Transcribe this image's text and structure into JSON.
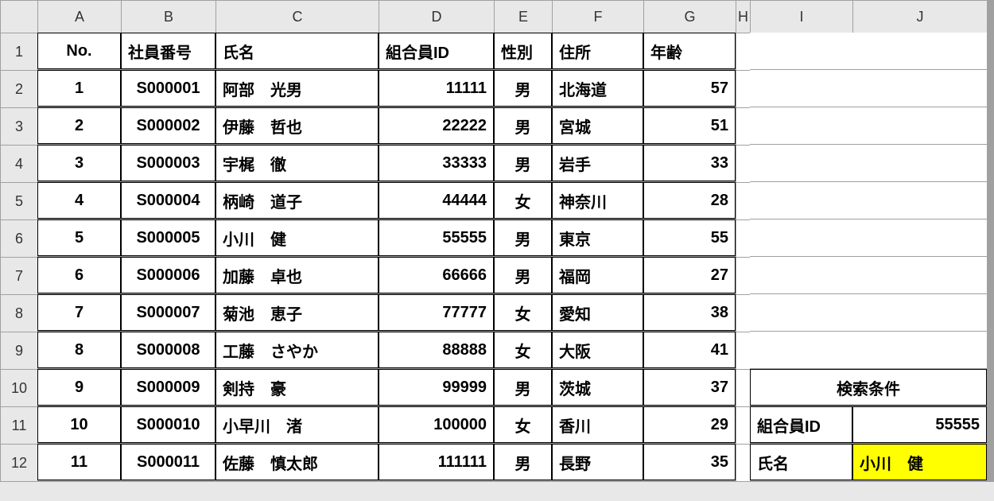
{
  "colHeaders": [
    "A",
    "B",
    "C",
    "D",
    "E",
    "F",
    "G",
    "H",
    "I",
    "J"
  ],
  "rowHeaders": [
    "1",
    "2",
    "3",
    "4",
    "5",
    "6",
    "7",
    "8",
    "9",
    "10",
    "11",
    "12"
  ],
  "headers": {
    "no": "No.",
    "empId": "社員番号",
    "name": "氏名",
    "unionId": "組合員ID",
    "gender": "性別",
    "address": "住所",
    "age": "年齢"
  },
  "rows": [
    {
      "no": "1",
      "empId": "S000001",
      "name": "阿部　光男",
      "unionId": "11111",
      "gender": "男",
      "address": "北海道",
      "age": "57"
    },
    {
      "no": "2",
      "empId": "S000002",
      "name": "伊藤　哲也",
      "unionId": "22222",
      "gender": "男",
      "address": "宮城",
      "age": "51"
    },
    {
      "no": "3",
      "empId": "S000003",
      "name": "宇梶　徹",
      "unionId": "33333",
      "gender": "男",
      "address": "岩手",
      "age": "33"
    },
    {
      "no": "4",
      "empId": "S000004",
      "name": "柄崎　道子",
      "unionId": "44444",
      "gender": "女",
      "address": "神奈川",
      "age": "28"
    },
    {
      "no": "5",
      "empId": "S000005",
      "name": "小川　健",
      "unionId": "55555",
      "gender": "男",
      "address": "東京",
      "age": "55"
    },
    {
      "no": "6",
      "empId": "S000006",
      "name": "加藤　卓也",
      "unionId": "66666",
      "gender": "男",
      "address": "福岡",
      "age": "27"
    },
    {
      "no": "7",
      "empId": "S000007",
      "name": "菊池　恵子",
      "unionId": "77777",
      "gender": "女",
      "address": "愛知",
      "age": "38"
    },
    {
      "no": "8",
      "empId": "S000008",
      "name": "工藤　さやか",
      "unionId": "88888",
      "gender": "女",
      "address": "大阪",
      "age": "41"
    },
    {
      "no": "9",
      "empId": "S000009",
      "name": "剣持　豪",
      "unionId": "99999",
      "gender": "男",
      "address": "茨城",
      "age": "37"
    },
    {
      "no": "10",
      "empId": "S000010",
      "name": "小早川　渚",
      "unionId": "100000",
      "gender": "女",
      "address": "香川",
      "age": "29"
    },
    {
      "no": "11",
      "empId": "S000011",
      "name": "佐藤　慎太郎",
      "unionId": "111111",
      "gender": "男",
      "address": "長野",
      "age": "35"
    }
  ],
  "search": {
    "title": "検索条件",
    "unionIdLabel": "組合員ID",
    "unionIdValue": "55555",
    "nameLabel": "氏名",
    "nameValue": "小川　健"
  }
}
